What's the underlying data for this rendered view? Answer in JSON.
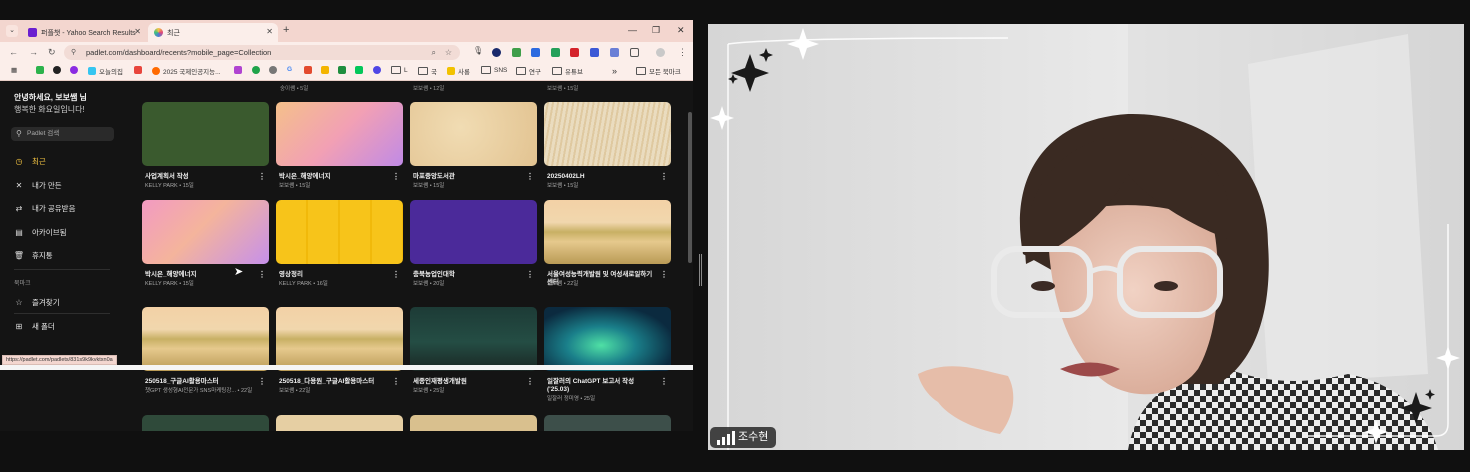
{
  "browser": {
    "tabs": [
      {
        "title": "퍼플챗 - Yahoo Search Results",
        "icon": "yahoo-icon"
      },
      {
        "title": "최근",
        "icon": "padlet-icon"
      }
    ],
    "address": "padlet.com/dashboard/recents?mobile_page=Collection",
    "bookmarks": [
      {
        "label": "오늘의집",
        "icon": "bookmark-favicon"
      },
      {
        "label": "2025 국제인공지능...",
        "icon": "bookmark-favicon"
      },
      {
        "label": "L",
        "icon": "folder-icon"
      },
      {
        "label": "국",
        "icon": "folder-icon"
      },
      {
        "label": "사룡",
        "icon": "bookmark-favicon"
      },
      {
        "label": "SNS",
        "icon": "folder-icon"
      },
      {
        "label": "연구",
        "icon": "folder-icon"
      },
      {
        "label": "유튜브",
        "icon": "folder-icon"
      },
      {
        "label": "모든 북마크",
        "icon": "folder-icon"
      }
    ],
    "status_url": "https://padlet.com/padlets/831s9k9kvktxn0a"
  },
  "padlet": {
    "greeting": "안녕하세요, 보보쌤 님",
    "subgreeting": "행복한 화요일입니다!",
    "search_placeholder": "Padlet 검색",
    "nav": [
      {
        "label": "최근",
        "icon": "clock-icon",
        "active": true
      },
      {
        "label": "내가 만든",
        "icon": "shapes-icon",
        "active": false
      },
      {
        "label": "내가 공유받음",
        "icon": "share-icon",
        "active": false
      },
      {
        "label": "아카이브됨",
        "icon": "archive-icon",
        "active": false
      },
      {
        "label": "휴지통",
        "icon": "trash-icon",
        "active": false
      }
    ],
    "bookmarks_heading": "북마크",
    "bookmark_nav": [
      {
        "label": "즐겨찾기",
        "icon": "folder-star-icon"
      },
      {
        "label": "새 폴더",
        "icon": "folder-plus-icon"
      }
    ],
    "partial_top_meta": [
      "숭이쌤 • 5일",
      "보보쌤 • 12일",
      "보보쌤 • 15일"
    ],
    "cards": [
      {
        "title": "사업계획서 작성",
        "meta": "KELLY PARK • 15일",
        "thumb": "green"
      },
      {
        "title": "박시은_해양에너지",
        "meta": "보보쌤 • 15일",
        "thumb": "pinkgrad"
      },
      {
        "title": "마포중앙도서관",
        "meta": "보보쌤 • 15일",
        "thumb": "paper"
      },
      {
        "title": "20250402LH",
        "meta": "보보쌤 • 15일",
        "thumb": "wheat"
      },
      {
        "title": "박시은_해양에너지",
        "meta": "KELLY PARK • 15일",
        "thumb": "pinkgrad2"
      },
      {
        "title": "영상정리",
        "meta": "KELLY PARK • 16일",
        "thumb": "yellow"
      },
      {
        "title": "충북농업인대학",
        "meta": "보보쌤 • 20일",
        "thumb": "purple"
      },
      {
        "title": "서울여성능력개발원 및 여성새로일하기센터",
        "meta": "보보쌤 • 22일",
        "thumb": "landscape"
      },
      {
        "title": "250518_구글AI활용마스터",
        "meta": "챗GPT 생성형AI전문가 SNS마케팅강... • 22일",
        "thumb": "landscape"
      },
      {
        "title": "250518_다용원_구글AI활용마스터",
        "meta": "보보쌤 • 22일",
        "thumb": "landscape"
      },
      {
        "title": "세종인재평생개발원",
        "meta": "보보쌤 • 25일",
        "thumb": "hopper"
      },
      {
        "title": "일잘러의 ChatGPT 보고서 작성 ('25.03)",
        "meta": "일잘러 정미영 • 25일",
        "thumb": "aurora"
      }
    ]
  },
  "video": {
    "participant_name": "조수현"
  }
}
